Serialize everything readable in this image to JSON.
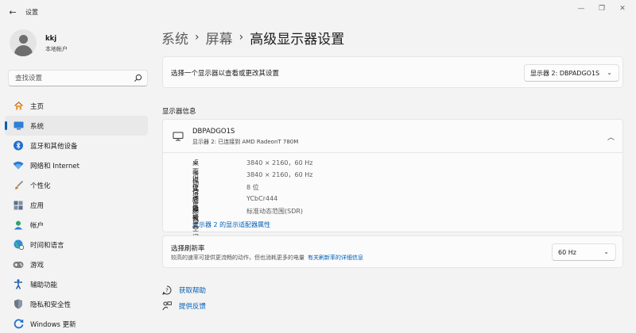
{
  "window": {
    "title": "设置"
  },
  "user": {
    "name": "kkj",
    "account_type": "本地帐户"
  },
  "search": {
    "placeholder": "查找设置"
  },
  "sidebar": {
    "items": [
      {
        "label": "主页",
        "icon": "home-icon"
      },
      {
        "label": "系统",
        "icon": "system-icon",
        "active": true
      },
      {
        "label": "蓝牙和其他设备",
        "icon": "bluetooth-icon"
      },
      {
        "label": "网络和 Internet",
        "icon": "wifi-icon"
      },
      {
        "label": "个性化",
        "icon": "brush-icon"
      },
      {
        "label": "应用",
        "icon": "apps-icon"
      },
      {
        "label": "帐户",
        "icon": "account-icon"
      },
      {
        "label": "时间和语言",
        "icon": "globe-clock-icon"
      },
      {
        "label": "游戏",
        "icon": "gamepad-icon"
      },
      {
        "label": "辅助功能",
        "icon": "accessibility-icon"
      },
      {
        "label": "隐私和安全性",
        "icon": "shield-icon"
      },
      {
        "label": "Windows 更新",
        "icon": "update-icon"
      }
    ]
  },
  "breadcrumb": {
    "items": [
      "系统",
      "屏幕",
      "高级显示器设置"
    ]
  },
  "display_select": {
    "label": "选择一个显示器以查看或更改其设置",
    "value": "显示器 2: DBPADGO1S"
  },
  "display_info": {
    "section_title": "显示器信息",
    "monitor_name": "DBPADGO1S",
    "monitor_subtitle": "显示器 2: 已连接到 AMD RadeonT 780M",
    "rows": [
      {
        "key": "桌面模式",
        "value": "3840 × 2160，60 Hz"
      },
      {
        "key": "活动信号模式",
        "value": "3840 × 2160，60 Hz"
      },
      {
        "key": "位深度",
        "value": "8 位"
      },
      {
        "key": "颜色格式",
        "value": "YCbCr444"
      },
      {
        "key": "颜色空间",
        "value": "标准动态范围(SDR)"
      }
    ],
    "adapter_link": "显示器 2 的显示适配器属性"
  },
  "refresh": {
    "title": "选择刷新率",
    "description": "较高的速率可提供更流畅的动作，但也消耗更多的电量",
    "link": "有关刷新率的详细信息",
    "value": "60 Hz"
  },
  "help_links": {
    "get_help": "获取帮助",
    "feedback": "提供反馈"
  },
  "colors": {
    "accent": "#005fb8",
    "background": "#f3f3f3",
    "card": "#fbfbfb"
  }
}
